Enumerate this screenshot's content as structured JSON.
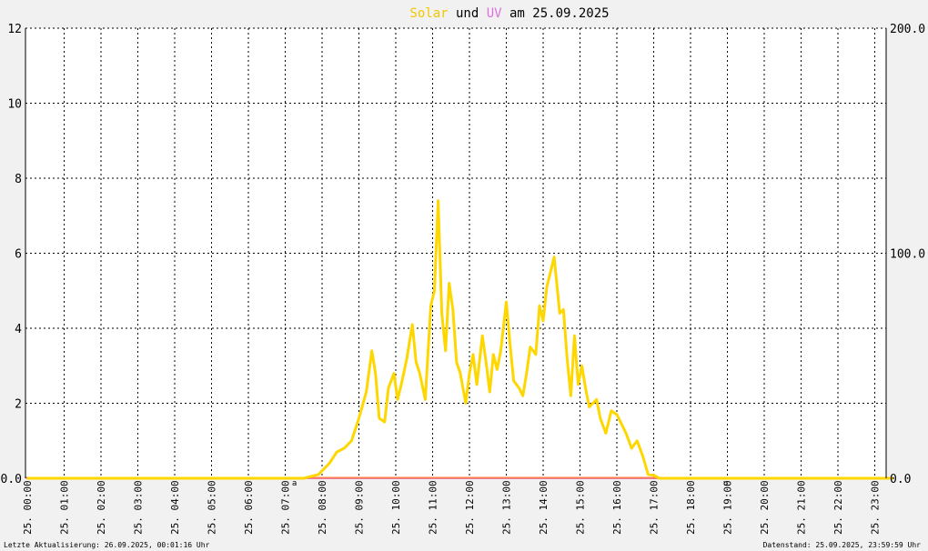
{
  "title": {
    "part_solar": "Solar",
    "part_und": " und ",
    "part_uv": "UV",
    "part_date": " am 25.09.2025"
  },
  "footer": {
    "left": "Letzte Aktualisierung: 26.09.2025, 00:01:16 Uhr",
    "right": "Datenstand: 25.09.2025, 23:59:59 Uhr"
  },
  "colors": {
    "background": "#f1f1f1",
    "plot_background": "#ffffff",
    "solar": "#ffd700",
    "solar_title": "#f2c700",
    "uv": "#e070e0",
    "baseline": "#ff7f50",
    "grid": "#000000",
    "marker": "#ff0000"
  },
  "chart_data": {
    "type": "line",
    "title": "Solar und UV am 25.09.2025",
    "x_unit": "hour of day 25.09.2025",
    "x_range": [
      0,
      23.5
    ],
    "x_tick_labels": [
      "25. 00:00",
      "25. 01:00",
      "25. 02:00",
      "25. 03:00",
      "25. 04:00",
      "25. 05:00",
      "25. 06:00",
      "25. 07:00",
      "25. 08:00",
      "25. 09:00",
      "25. 10:00",
      "25. 11:00",
      "25. 12:00",
      "25. 13:00",
      "25. 14:00",
      "25. 15:00",
      "25. 16:00",
      "25. 17:00",
      "25. 18:00",
      "25. 19:00",
      "25. 20:00",
      "25. 21:00",
      "25. 22:00",
      "25. 23:00"
    ],
    "y_left": {
      "range": [
        0,
        12
      ],
      "ticks": [
        "0.0",
        "2",
        "4",
        "6",
        "8",
        "10",
        "12"
      ]
    },
    "y_right": {
      "range": [
        0,
        200
      ],
      "ticks": [
        "0.0",
        "100.0",
        "200.0"
      ]
    },
    "grid": true,
    "markers": [
      {
        "label": "a",
        "x": 7.25
      },
      {
        "label": "u",
        "x": 18.95
      }
    ],
    "series": [
      {
        "name": "Solar",
        "axis": "left",
        "x": [
          0,
          7.5,
          7.7,
          7.9,
          8.0,
          8.2,
          8.4,
          8.6,
          8.8,
          9.0,
          9.2,
          9.35,
          9.45,
          9.55,
          9.7,
          9.8,
          9.95,
          10.05,
          10.15,
          10.3,
          10.45,
          10.55,
          10.65,
          10.8,
          10.95,
          11.05,
          11.15,
          11.25,
          11.35,
          11.45,
          11.55,
          11.65,
          11.75,
          11.9,
          12.0,
          12.1,
          12.2,
          12.35,
          12.45,
          12.55,
          12.65,
          12.75,
          12.85,
          13.0,
          13.1,
          13.2,
          13.35,
          13.45,
          13.55,
          13.65,
          13.8,
          13.9,
          14.0,
          14.1,
          14.2,
          14.3,
          14.45,
          14.55,
          14.65,
          14.75,
          14.85,
          14.95,
          15.05,
          15.15,
          15.25,
          15.35,
          15.45,
          15.55,
          15.7,
          15.85,
          16.0,
          16.15,
          16.25,
          16.4,
          16.55,
          16.7,
          16.85,
          17.0,
          17.15,
          17.3,
          17.45,
          17.6,
          17.75,
          17.85,
          17.95,
          18.1,
          18.25,
          23.5
        ],
        "y": [
          0,
          0,
          0.05,
          0.1,
          0.2,
          0.4,
          0.7,
          0.8,
          1.0,
          1.6,
          2.3,
          3.4,
          2.8,
          1.6,
          1.5,
          2.4,
          2.8,
          2.1,
          2.5,
          3.2,
          4.1,
          3.1,
          2.8,
          2.1,
          4.6,
          5.0,
          7.4,
          4.4,
          3.4,
          5.2,
          4.5,
          3.1,
          2.8,
          2.0,
          2.8,
          3.3,
          2.5,
          3.8,
          3.1,
          2.3,
          3.3,
          2.9,
          3.4,
          4.7,
          3.6,
          2.6,
          2.4,
          2.2,
          2.8,
          3.5,
          3.3,
          4.6,
          4.2,
          5.1,
          5.5,
          5.9,
          4.4,
          4.5,
          3.2,
          2.2,
          3.8,
          2.5,
          3.0,
          2.4,
          1.9,
          2.0,
          2.1,
          1.6,
          1.2,
          1.8,
          1.7,
          1.4,
          1.2,
          0.8,
          1.0,
          0.6,
          0.1,
          0.08,
          0,
          0,
          0,
          0,
          0,
          0,
          0,
          0,
          0,
          0
        ]
      },
      {
        "name": "UV",
        "axis": "right",
        "x": [
          0,
          23.5
        ],
        "y": [
          0,
          0
        ]
      }
    ]
  }
}
